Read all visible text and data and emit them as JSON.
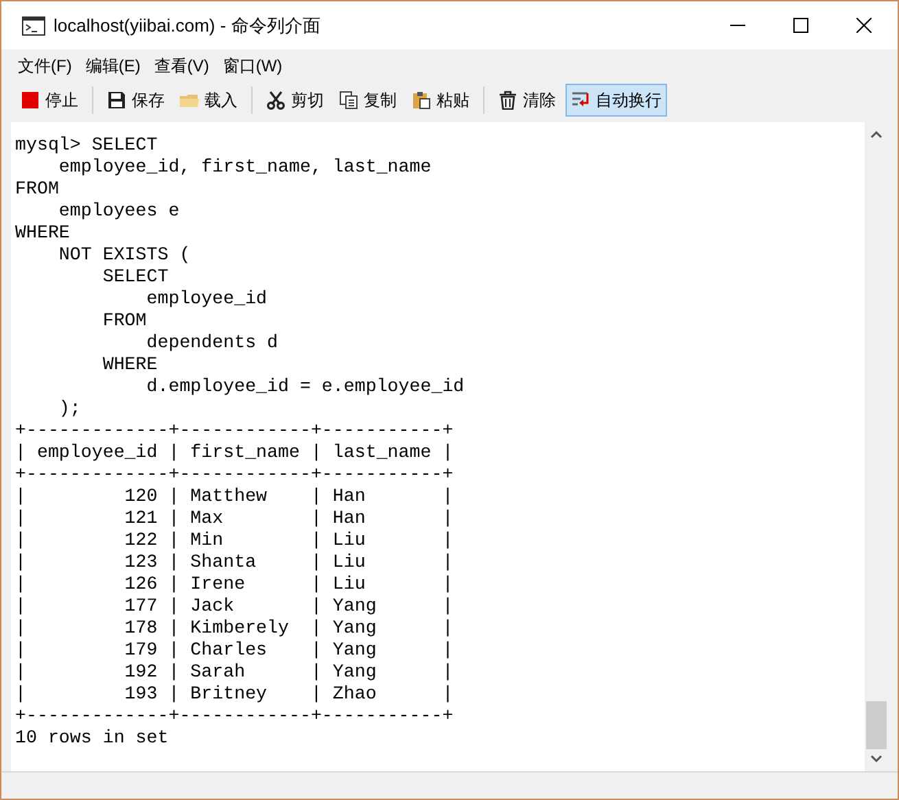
{
  "window": {
    "title": "localhost(yiibai.com) - 命令列介面"
  },
  "menu": [
    "文件(F)",
    "编辑(E)",
    "查看(V)",
    "窗口(W)"
  ],
  "toolbar": [
    {
      "kind": "stop",
      "label": "停止",
      "on": false
    },
    {
      "kind": "save",
      "label": "保存",
      "on": false
    },
    {
      "kind": "load",
      "label": "载入",
      "on": false
    },
    {
      "kind": "cut",
      "label": "剪切",
      "on": false
    },
    {
      "kind": "copy",
      "label": "复制",
      "on": false
    },
    {
      "kind": "paste",
      "label": "粘贴",
      "on": false
    },
    {
      "kind": "clear",
      "label": "清除",
      "on": false
    },
    {
      "kind": "wrap",
      "label": "自动换行",
      "on": true
    }
  ],
  "console": {
    "lines": [
      "mysql> SELECT",
      "    employee_id, first_name, last_name",
      "FROM",
      "    employees e",
      "WHERE",
      "    NOT EXISTS (",
      "        SELECT",
      "            employee_id",
      "        FROM",
      "            dependents d",
      "        WHERE",
      "            d.employee_id = e.employee_id",
      "    );",
      "+-------------+------------+-----------+",
      "| employee_id | first_name | last_name |",
      "+-------------+------------+-----------+",
      "|         120 | Matthew    | Han       |",
      "|         121 | Max        | Han       |",
      "|         122 | Min        | Liu       |",
      "|         123 | Shanta     | Liu       |",
      "|         126 | Irene      | Liu       |",
      "|         177 | Jack       | Yang      |",
      "|         178 | Kimberely  | Yang      |",
      "|         179 | Charles    | Yang      |",
      "|         192 | Sarah      | Yang      |",
      "|         193 | Britney    | Zhao      |",
      "+-------------+------------+-----------+",
      "10 rows in set"
    ]
  }
}
